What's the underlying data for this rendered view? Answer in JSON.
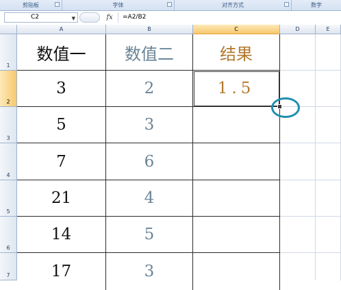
{
  "ribbon": {
    "groups": [
      "剪贴板",
      "字体",
      "对齐方式",
      "数字"
    ]
  },
  "formula_bar": {
    "name_box": "C2",
    "fx_label": "fx",
    "formula": "=A2/B2"
  },
  "sheet": {
    "columns": [
      "A",
      "B",
      "C",
      "D",
      "E"
    ],
    "rows": [
      "1",
      "2",
      "3",
      "4",
      "5",
      "6",
      "7"
    ],
    "selected_cell": "C2",
    "header_row": [
      "数值一",
      "数值二",
      "结果"
    ],
    "data_rows": [
      [
        "3",
        "2",
        "1.5"
      ],
      [
        "5",
        "3",
        ""
      ],
      [
        "7",
        "6",
        ""
      ],
      [
        "21",
        "4",
        ""
      ],
      [
        "14",
        "5",
        ""
      ],
      [
        "17",
        "3",
        ""
      ]
    ]
  },
  "colors": {
    "col_a_text": "#111111",
    "col_b_text": "#6a8497",
    "col_c_text": "#b3792e",
    "selection_header": "#f8c86e",
    "marker_circle": "#1f8fae"
  }
}
